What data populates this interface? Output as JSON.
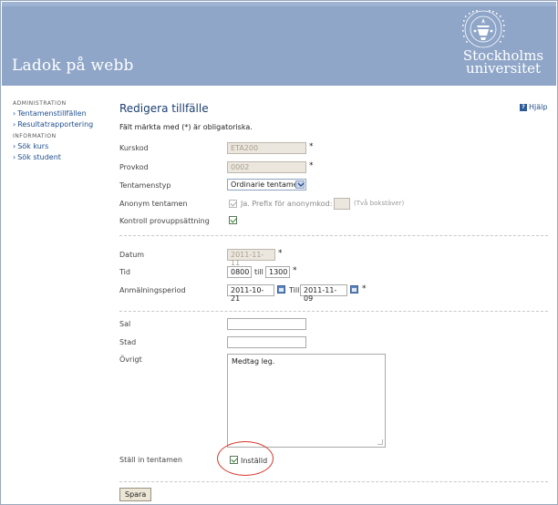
{
  "header": {
    "app_title": "Ladok på webb",
    "logo_line1": "Stockholms",
    "logo_line2": "universitet",
    "seal_text": "STOCKHOLMS UNIVERSITET"
  },
  "sidebar": {
    "sections": [
      {
        "heading": "ADMINISTRATION",
        "links": [
          "Tentamenstillfällen",
          "Resultatrapportering"
        ]
      },
      {
        "heading": "INFORMATION",
        "links": [
          "Sök kurs",
          "Sök student"
        ]
      }
    ]
  },
  "page": {
    "title": "Redigera tillfälle",
    "help_label": "Hjälp",
    "required_note": "Fält märkta med (*) är obligatoriska."
  },
  "form": {
    "kurskod": {
      "label": "Kurskod",
      "value": "ETA200"
    },
    "provkod": {
      "label": "Provkod",
      "value": "0002"
    },
    "tentamenstyp": {
      "label": "Tentamenstyp",
      "value": "Ordinarie tentamen"
    },
    "anonym": {
      "label": "Anonym tentamen",
      "checkbox_label": "Ja. Prefix för anonymkod:",
      "hint": "(Två bokstäver)",
      "checked": true,
      "prefix_value": ""
    },
    "kontroll": {
      "label": "Kontroll provuppsättning",
      "checked": true
    },
    "datum": {
      "label": "Datum",
      "value": "2011-11-11"
    },
    "tid": {
      "label": "Tid",
      "from": "0800",
      "till_label": "till",
      "to": "1300"
    },
    "anmalningsperiod": {
      "label": "Anmälningsperiod",
      "from": "2011-10-21",
      "till_label": "Till",
      "to": "2011-11-09"
    },
    "sal": {
      "label": "Sal",
      "value": ""
    },
    "stad": {
      "label": "Stad",
      "value": ""
    },
    "ovrigt": {
      "label": "Övrigt",
      "value": "Medtag leg."
    },
    "stall_in": {
      "label": "Ställ in tentamen",
      "checkbox_label": "Inställd",
      "checked": true
    },
    "required_marker": "*"
  },
  "actions": {
    "save_label": "Spara"
  },
  "colors": {
    "header_bg": "#8fa6c8",
    "title_color": "#1b3e72",
    "link_color": "#1f4f8f",
    "highlight_circle": "#d9342b"
  }
}
